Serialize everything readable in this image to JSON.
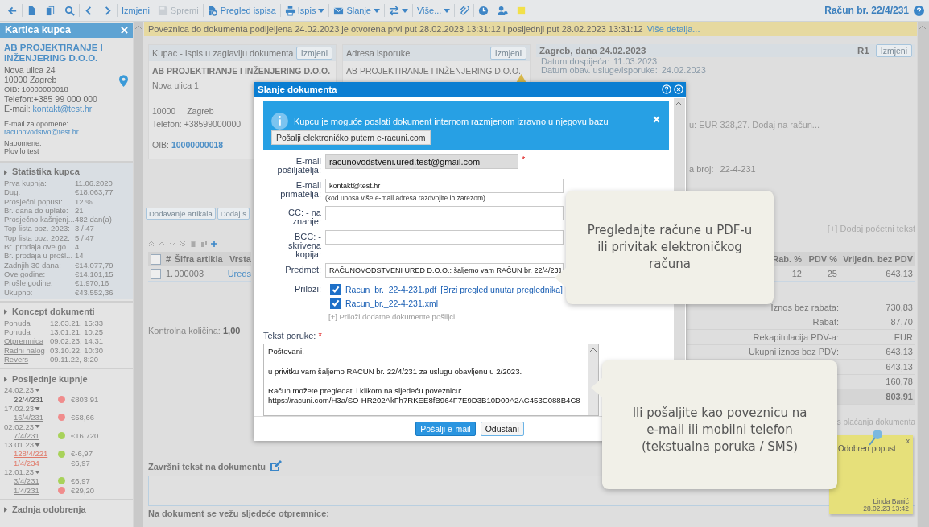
{
  "toolbar": {
    "buttons": [
      {
        "disabled": false,
        "dropdown": false
      },
      {
        "disabled": false,
        "dropdown": false
      },
      {
        "disabled": false,
        "dropdown": false
      },
      {
        "disabled": false,
        "dropdown": false
      },
      {
        "disabled": false,
        "dropdown": false
      },
      {
        "disabled": false,
        "dropdown": false
      },
      {
        "label": "Izmjeni",
        "disabled": false,
        "dropdown": false
      },
      {
        "label": "Spremi",
        "disabled": true,
        "dropdown": false
      },
      {
        "label": "Pregled ispisa",
        "disabled": false,
        "dropdown": false
      },
      {
        "label": "Ispis",
        "disabled": false,
        "dropdown": true
      },
      {
        "label": "Slanje",
        "disabled": false,
        "dropdown": true
      },
      {
        "disabled": false,
        "dropdown": true
      },
      {
        "label": "Više...",
        "disabled": false,
        "dropdown": true
      },
      {
        "disabled": false,
        "dropdown": false
      },
      {
        "disabled": false,
        "dropdown": false
      },
      {
        "disabled": false,
        "dropdown": false
      },
      {
        "disabled": false,
        "dropdown": false
      }
    ],
    "title": "Račun br. 22/4/231"
  },
  "sidebar": {
    "title": "Kartica kupca",
    "company": "AB PROJEKTIRANJE I INŽENJERING D.O.O.",
    "address_lines": [
      "Nova ulica 24",
      "10000 Zagreb"
    ],
    "oib": "OIB: 10000000018",
    "phone": "Telefon:+385 99 000 000",
    "email_label": "E-mail:",
    "email": "kontakt@test.hr",
    "reminder_label": "E-mail za opomene:",
    "reminder_email": "racunovodstvo@test.hr",
    "notes_label": "Napomene:",
    "notes": "Plovilo test",
    "stats": {
      "title": "Statistika kupca",
      "rows": [
        {
          "label": "Prva kupnja:",
          "value": "11.06.2020"
        },
        {
          "label": "Dug:",
          "value": "€18.063,77"
        },
        {
          "label": "Prosječni popust:",
          "value": "12 %"
        },
        {
          "label": "Br. dana do uplate:",
          "value": "21"
        },
        {
          "label": "Prosječno kašnjenj...",
          "value": "482 dan(a)"
        },
        {
          "label": "Top lista poz. 2023:",
          "value": "3 / 47"
        },
        {
          "label": "Top lista poz. 2022:",
          "value": "5 / 47"
        },
        {
          "label": "Br. prodaja ove go...",
          "value": "4"
        },
        {
          "label": "Br. prodaja u prošl...",
          "value": "14"
        },
        {
          "label": "Zadnjih 30 dana:",
          "value": "€14.077,79"
        },
        {
          "label": "Ove godine:",
          "value": "€14.101,15"
        },
        {
          "label": "Prošle godine:",
          "value": "€1.970,16"
        },
        {
          "label": "Ukupno:",
          "value": "€43.552,36"
        }
      ]
    },
    "drafts": {
      "title": "Koncept dokumenti",
      "rows": [
        {
          "label": "Ponuda",
          "value": "12.03.21, 15:33"
        },
        {
          "label": "Ponuda",
          "value": "13.01.21, 10:25"
        },
        {
          "label": "Otpremnica",
          "value": "09.02.23, 14:31"
        },
        {
          "label": "Radni nalog",
          "value": "03.10.22, 10:30"
        },
        {
          "label": "Revers",
          "value": "09.11.22, 8:20"
        }
      ]
    },
    "purchases": {
      "title": "Posljednje kupnje",
      "groups": [
        {
          "date": "24.02.23",
          "items": [
            {
              "number": "22/4/231",
              "kind": "current",
              "color": "#f08c8c",
              "amount": "€803,91"
            }
          ]
        },
        {
          "date": "17.02.23",
          "items": [
            {
              "number": "16/4/231",
              "kind": "link",
              "color": "#f08c8c",
              "amount": "€58,66"
            }
          ]
        },
        {
          "date": "02.02.23",
          "items": [
            {
              "number": "7/4/231",
              "kind": "link",
              "color": "#a8d25a",
              "amount": "€16.720"
            }
          ]
        },
        {
          "date": "13.01.23",
          "items": [
            {
              "number": "128/4/221",
              "kind": "storno",
              "color": "#a8d25a",
              "amount": "€-6,97"
            },
            {
              "number": "1/4/234",
              "kind": "storno",
              "amount": "€6,97"
            }
          ]
        },
        {
          "date": "12.01.23",
          "items": [
            {
              "number": "3/4/231",
              "kind": "faded",
              "color": "#a8d25a",
              "amount": "€6,97"
            },
            {
              "number": "1/4/231",
              "kind": "link",
              "color": "#f08c8c",
              "amount": "€29,20"
            }
          ]
        }
      ]
    },
    "approvals": {
      "title": "Zadnja odobrenja"
    }
  },
  "notice": {
    "text": "Poveznica do dokumenta podijeljena 24.02.2023 je otvorena prvi put 28.02.2023 13:31:12 i posljednji put 28.02.2023 13:31:12",
    "link": "Više detalja..."
  },
  "buyer": {
    "title": "Kupac - ispis u zaglavlju dokumenta",
    "button": "Izmjeni",
    "name": "AB PROJEKTIRANJE I INŽENJERING D.O.O.",
    "street": "Nova ulica 1",
    "postcode": "10000",
    "city": "Zagreb",
    "phone": "Telefon: +38599000000",
    "oib_label": "OIB:",
    "oib": "10000000018"
  },
  "delivery": {
    "title": "Adresa isporuke",
    "button": "Izmjeni",
    "name": "AB PROJEKTIRANJE I INŽENJERING D.O.O.",
    "warning": true
  },
  "header": {
    "title": "Zagreb, dana 24.02.2023",
    "type": "R1",
    "button": "Izmjeni",
    "rows": [
      {
        "label": "Datum dospijeća:",
        "value": "11.03.2023"
      },
      {
        "label": "Datum obav. usluge/isporuke:",
        "value": "24.02.2023"
      }
    ],
    "advance": "u: EUR 328,27. Dodaj na račun...",
    "ref_label": "a broj:",
    "ref_value": "22-4-231",
    "add_text": "[+] Dodaj početni tekst"
  },
  "item_buttons": [
    "Dodavanje artikala",
    "Dodaj s"
  ],
  "items": {
    "select_all_checked": false,
    "columns_left": [
      "#",
      "Šifra artikla",
      "Vrsta"
    ],
    "columns_right": [
      "Rab. %",
      "PDV %",
      "Vrijedn. bez PDV"
    ],
    "rows": [
      {
        "checked": false,
        "index": "1.",
        "code": "000003",
        "type": "Ureds",
        "discount": "12",
        "vat": "25",
        "value": "643,13"
      }
    ]
  },
  "control_qty": {
    "label": "Kontrolna količina:",
    "value": "1,00"
  },
  "totals": [
    {
      "label": "Iznos bez rabata:",
      "value": "730,83",
      "bold": false
    },
    {
      "label": "Rabat:",
      "value": "-87,70",
      "bold": false
    },
    {
      "label": "Rekapitulacija PDV-a:",
      "value": "EUR",
      "bold": false
    },
    {
      "label": "Ukupni iznos bez PDV:",
      "value": "643,13",
      "bold": false
    },
    {
      "value": "643,13",
      "bold": false
    },
    {
      "value": "160,78",
      "bold": false
    },
    {
      "value": "803,91",
      "bold": true
    }
  ],
  "payments_link": "s plaćanja dokumenta",
  "closing": {
    "title": "Završni tekst na dokumentu",
    "delivery_notes": "Na dokument se vežu sljedeće otpremnice:"
  },
  "note": {
    "title": "Odobren popust",
    "close": "x",
    "author": "Linda Banić",
    "time": "28.02.23 13:42"
  },
  "dialog": {
    "title": "Slanje dokumenta",
    "info": {
      "text": "Kupcu je moguće poslati dokument internom razmjenom izravno u njegovu bazu",
      "button": "Pošalji elektroničko putem e-racuni.com"
    },
    "fields": [
      {
        "label": "E-mail pošiljatelja:",
        "value": "racunovodstveni.ured.test@gmail.com",
        "kind": "readonly",
        "mark": "*"
      },
      {
        "label": "E-mail primatelja:",
        "value": "kontakt@test.hr",
        "kind": "text",
        "hint": "(kod unosa više e-mail adresa razdvojite ih zarezom)"
      },
      {
        "label": "CC: - na znanje:",
        "kind": "text"
      },
      {
        "label": "BCC: - skrivena kopija:",
        "kind": "text"
      },
      {
        "label": "Predmet:",
        "value": "RAČUNOVODSTVENI URED D.O.O.: šaljemo vam RAČUN br. 22/4/231",
        "kind": "text"
      }
    ],
    "attachments_label": "Prilozi:",
    "attachments": [
      {
        "name": "Racun_br._22-4-231.pdf",
        "preview": "[Brzi pregled unutar preglednika]",
        "checked": true
      },
      {
        "name": "Racun_br._22-4-231.xml",
        "checked": true
      }
    ],
    "add_attachment": "[+] Priloži dodatne dokumente pošiljci...",
    "message_label": "Tekst poruke:",
    "message_mark": "*",
    "message": "Poštovani,\n\nu privitku vam šaljemo RAČUN br. 22/4/231 za uslugu obavljenu u 2/2023.\n\nRačun možete pregledati i klikom na sljedeću poveznicu:\nhttps://racuni.com/H3a/SO-HR202AkFh7RKEE8fB964F7E9D3B10D00A2AC453C088B4C8",
    "buttons": [
      {
        "label": "Pošalji e-mail",
        "kind": "primary"
      },
      {
        "label": "Odustani",
        "kind": "secondary"
      }
    ]
  },
  "callouts": [
    {
      "text": "Pregledajte račune u PDF-u\nili privitak elektroničkog\nračuna"
    },
    {
      "text": "Ili pošaljite kao poveznicu na\ne-mail ili mobilni telefon\n(tekstualna poruka / SMS)"
    }
  ]
}
